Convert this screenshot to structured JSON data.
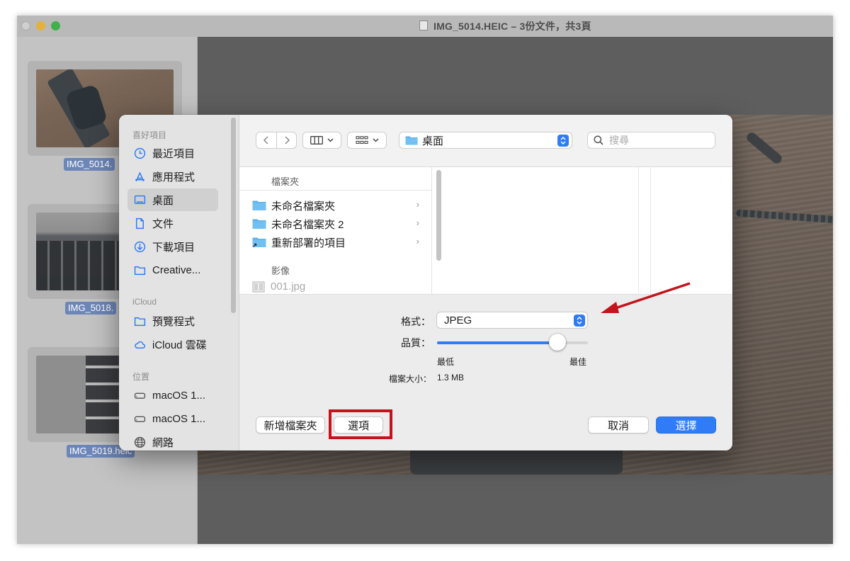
{
  "window": {
    "title": "IMG_5014.HEIC – 3份文件，共3頁",
    "thumbnails": [
      {
        "label": "IMG_5014."
      },
      {
        "label": "IMG_5018."
      },
      {
        "label": "IMG_5019.heic"
      }
    ]
  },
  "dialog": {
    "sidebar": {
      "favorites_header": "喜好項目",
      "favorites": [
        {
          "label": "最近項目",
          "icon": "clock-icon"
        },
        {
          "label": "應用程式",
          "icon": "apps-icon"
        },
        {
          "label": "桌面",
          "icon": "desktop-icon",
          "selected": true
        },
        {
          "label": "文件",
          "icon": "document-icon"
        },
        {
          "label": "下載項目",
          "icon": "download-icon"
        },
        {
          "label": "Creative...",
          "icon": "folder-icon"
        }
      ],
      "icloud_header": "iCloud",
      "icloud": [
        {
          "label": "預覽程式",
          "icon": "folder-icon"
        },
        {
          "label": "iCloud 雲碟",
          "icon": "cloud-icon"
        }
      ],
      "locations_header": "位置",
      "locations": [
        {
          "label": "macOS 1...",
          "icon": "disk-icon"
        },
        {
          "label": "macOS 1...",
          "icon": "disk-icon"
        },
        {
          "label": "網路",
          "icon": "globe-icon"
        }
      ]
    },
    "toolbar": {
      "location": "桌面",
      "search_placeholder": "搜尋"
    },
    "browser": {
      "folders_header": "檔案夾",
      "folders": [
        {
          "name": "未命名檔案夾"
        },
        {
          "name": "未命名檔案夾 2"
        },
        {
          "name": "重新部署的項目"
        }
      ],
      "images_header": "影像",
      "images": [
        {
          "name": "001.jpg"
        }
      ]
    },
    "options": {
      "format_label": "格式：",
      "format_value": "JPEG",
      "quality_label": "品質：",
      "quality_level": 0.8,
      "quality_min": "最低",
      "quality_max": "最佳",
      "filesize_label": "檔案大小：",
      "filesize_value": "1.3 MB"
    },
    "buttons": {
      "new_folder": "新增檔案夾",
      "options": "選項",
      "cancel": "取消",
      "choose": "選擇"
    }
  },
  "colors": {
    "accent": "#2f7cf6",
    "annotation": "#c4131b"
  }
}
